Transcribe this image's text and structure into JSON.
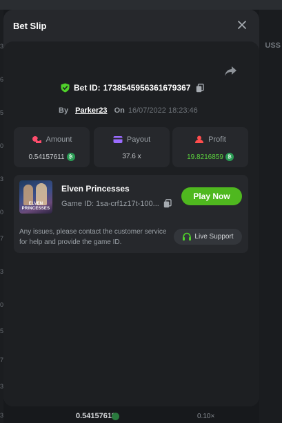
{
  "background": {
    "currency_label": "USS",
    "edge_numbers": [
      "3",
      "6",
      "5",
      "0",
      "3",
      "0",
      "7",
      "3",
      "0",
      "5",
      "7",
      "3",
      "3"
    ],
    "bottom_value": "0.54157611",
    "bottom_multiplier": "0.10×"
  },
  "modal": {
    "title": "Bet Slip",
    "close_icon": "close-icon",
    "share_icon": "share-icon"
  },
  "bet": {
    "id_prefix": "Bet ID:",
    "id_value": "1738545956361679367",
    "by_label": "By",
    "player": "Parker23",
    "on_label": "On",
    "date": "16/07/2022 18:23:46"
  },
  "stats": [
    {
      "label": "Amount",
      "value": "0.54157611",
      "icon": "coins-icon",
      "icon_color": "#ff4d6d",
      "value_color": "#c7cacd",
      "has_coin": true
    },
    {
      "label": "Payout",
      "value": "37.6 x",
      "icon": "card-icon",
      "icon_color": "#9b6cff",
      "value_color": "#c7cacd",
      "has_coin": false
    },
    {
      "label": "Profit",
      "value": "19.8216859",
      "icon": "profit-icon",
      "icon_color": "#ff4d4d",
      "value_color": "#5bd13e",
      "has_coin": true
    }
  ],
  "game": {
    "name": "Elven Princesses",
    "id_text": "Game ID: 1sa-crf1z17t-100...",
    "thumb_logo": "ELVEN PRINCESSES",
    "play_label": "Play Now"
  },
  "support": {
    "text": "Any issues, please contact the customer service for help and provide the game ID.",
    "button_label": "Live Support"
  },
  "colors": {
    "accent_green": "#4fb81f",
    "coin_green": "#2a9b54",
    "shield_green": "#4fd12a"
  }
}
